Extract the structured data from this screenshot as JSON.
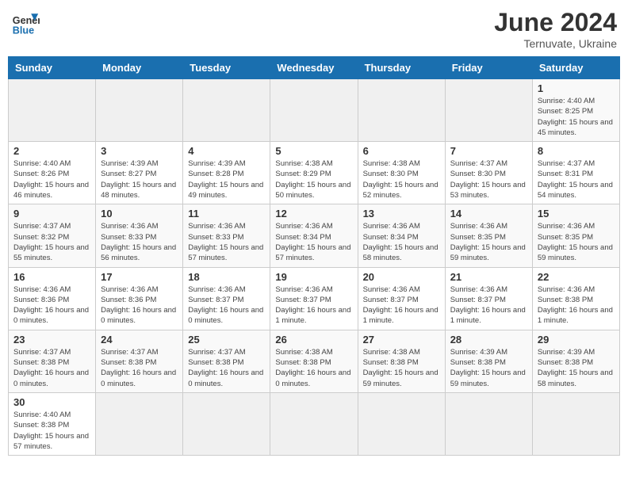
{
  "header": {
    "logo_line1": "General",
    "logo_line2": "Blue",
    "month": "June 2024",
    "location": "Ternuvate, Ukraine"
  },
  "weekdays": [
    "Sunday",
    "Monday",
    "Tuesday",
    "Wednesday",
    "Thursday",
    "Friday",
    "Saturday"
  ],
  "weeks": [
    [
      {
        "day": "",
        "info": ""
      },
      {
        "day": "",
        "info": ""
      },
      {
        "day": "",
        "info": ""
      },
      {
        "day": "",
        "info": ""
      },
      {
        "day": "",
        "info": ""
      },
      {
        "day": "",
        "info": ""
      },
      {
        "day": "1",
        "info": "Sunrise: 4:40 AM\nSunset: 8:25 PM\nDaylight: 15 hours\nand 45 minutes."
      }
    ],
    [
      {
        "day": "2",
        "info": "Sunrise: 4:40 AM\nSunset: 8:26 PM\nDaylight: 15 hours\nand 46 minutes."
      },
      {
        "day": "3",
        "info": "Sunrise: 4:39 AM\nSunset: 8:27 PM\nDaylight: 15 hours\nand 48 minutes."
      },
      {
        "day": "4",
        "info": "Sunrise: 4:39 AM\nSunset: 8:28 PM\nDaylight: 15 hours\nand 49 minutes."
      },
      {
        "day": "5",
        "info": "Sunrise: 4:38 AM\nSunset: 8:29 PM\nDaylight: 15 hours\nand 50 minutes."
      },
      {
        "day": "6",
        "info": "Sunrise: 4:38 AM\nSunset: 8:30 PM\nDaylight: 15 hours\nand 52 minutes."
      },
      {
        "day": "7",
        "info": "Sunrise: 4:37 AM\nSunset: 8:30 PM\nDaylight: 15 hours\nand 53 minutes."
      },
      {
        "day": "8",
        "info": "Sunrise: 4:37 AM\nSunset: 8:31 PM\nDaylight: 15 hours\nand 54 minutes."
      }
    ],
    [
      {
        "day": "9",
        "info": "Sunrise: 4:37 AM\nSunset: 8:32 PM\nDaylight: 15 hours\nand 55 minutes."
      },
      {
        "day": "10",
        "info": "Sunrise: 4:36 AM\nSunset: 8:33 PM\nDaylight: 15 hours\nand 56 minutes."
      },
      {
        "day": "11",
        "info": "Sunrise: 4:36 AM\nSunset: 8:33 PM\nDaylight: 15 hours\nand 57 minutes."
      },
      {
        "day": "12",
        "info": "Sunrise: 4:36 AM\nSunset: 8:34 PM\nDaylight: 15 hours\nand 57 minutes."
      },
      {
        "day": "13",
        "info": "Sunrise: 4:36 AM\nSunset: 8:34 PM\nDaylight: 15 hours\nand 58 minutes."
      },
      {
        "day": "14",
        "info": "Sunrise: 4:36 AM\nSunset: 8:35 PM\nDaylight: 15 hours\nand 59 minutes."
      },
      {
        "day": "15",
        "info": "Sunrise: 4:36 AM\nSunset: 8:35 PM\nDaylight: 15 hours\nand 59 minutes."
      }
    ],
    [
      {
        "day": "16",
        "info": "Sunrise: 4:36 AM\nSunset: 8:36 PM\nDaylight: 16 hours\nand 0 minutes."
      },
      {
        "day": "17",
        "info": "Sunrise: 4:36 AM\nSunset: 8:36 PM\nDaylight: 16 hours\nand 0 minutes."
      },
      {
        "day": "18",
        "info": "Sunrise: 4:36 AM\nSunset: 8:37 PM\nDaylight: 16 hours\nand 0 minutes."
      },
      {
        "day": "19",
        "info": "Sunrise: 4:36 AM\nSunset: 8:37 PM\nDaylight: 16 hours\nand 1 minute."
      },
      {
        "day": "20",
        "info": "Sunrise: 4:36 AM\nSunset: 8:37 PM\nDaylight: 16 hours\nand 1 minute."
      },
      {
        "day": "21",
        "info": "Sunrise: 4:36 AM\nSunset: 8:37 PM\nDaylight: 16 hours\nand 1 minute."
      },
      {
        "day": "22",
        "info": "Sunrise: 4:36 AM\nSunset: 8:38 PM\nDaylight: 16 hours\nand 1 minute."
      }
    ],
    [
      {
        "day": "23",
        "info": "Sunrise: 4:37 AM\nSunset: 8:38 PM\nDaylight: 16 hours\nand 0 minutes."
      },
      {
        "day": "24",
        "info": "Sunrise: 4:37 AM\nSunset: 8:38 PM\nDaylight: 16 hours\nand 0 minutes."
      },
      {
        "day": "25",
        "info": "Sunrise: 4:37 AM\nSunset: 8:38 PM\nDaylight: 16 hours\nand 0 minutes."
      },
      {
        "day": "26",
        "info": "Sunrise: 4:38 AM\nSunset: 8:38 PM\nDaylight: 16 hours\nand 0 minutes."
      },
      {
        "day": "27",
        "info": "Sunrise: 4:38 AM\nSunset: 8:38 PM\nDaylight: 15 hours\nand 59 minutes."
      },
      {
        "day": "28",
        "info": "Sunrise: 4:39 AM\nSunset: 8:38 PM\nDaylight: 15 hours\nand 59 minutes."
      },
      {
        "day": "29",
        "info": "Sunrise: 4:39 AM\nSunset: 8:38 PM\nDaylight: 15 hours\nand 58 minutes."
      }
    ],
    [
      {
        "day": "30",
        "info": "Sunrise: 4:40 AM\nSunset: 8:38 PM\nDaylight: 15 hours\nand 57 minutes."
      },
      {
        "day": "",
        "info": ""
      },
      {
        "day": "",
        "info": ""
      },
      {
        "day": "",
        "info": ""
      },
      {
        "day": "",
        "info": ""
      },
      {
        "day": "",
        "info": ""
      },
      {
        "day": "",
        "info": ""
      }
    ]
  ]
}
